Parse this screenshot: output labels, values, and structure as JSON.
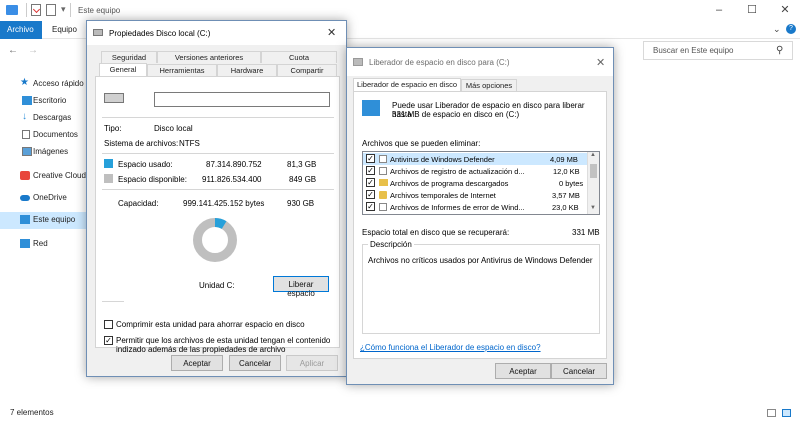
{
  "explorer": {
    "title": "Este equipo",
    "ribbon": {
      "file": "Archivo",
      "equipo": "Equipo"
    },
    "search_placeholder": "Buscar en Este equipo",
    "nav": [
      {
        "label": "Acceso rápido"
      },
      {
        "label": "Escritorio"
      },
      {
        "label": "Descargas"
      },
      {
        "label": "Documentos"
      },
      {
        "label": "Imágenes"
      },
      {
        "label": "Creative Cloud"
      },
      {
        "label": "OneDrive"
      },
      {
        "label": "Este equipo"
      },
      {
        "label": "Red"
      }
    ],
    "status": "7 elementos"
  },
  "props": {
    "title": "Propiedades Disco local (C:)",
    "tabs_top": [
      "Seguridad",
      "Versiones anteriores",
      "Cuota"
    ],
    "tabs_bottom": [
      "General",
      "Herramientas",
      "Hardware",
      "Compartir"
    ],
    "name_value": "",
    "type_label": "Tipo:",
    "type_value": "Disco local",
    "fs_label": "Sistema de archivos:",
    "fs_value": "NTFS",
    "used_label": "Espacio usado:",
    "used_bytes": "87.314.890.752",
    "used_gb": "81,3 GB",
    "free_label": "Espacio disponible:",
    "free_bytes": "911.826.534.400",
    "free_gb": "849 GB",
    "cap_label": "Capacidad:",
    "cap_bytes": "999.141.425.152 bytes",
    "cap_gb": "930 GB",
    "used_fraction": 0.087,
    "drive_label": "Unidad C:",
    "cleanup_button": "Liberar espacio",
    "compress_label": "Comprimir esta unidad para ahorrar espacio en disco",
    "index_label_1": "Permitir que los archivos de esta unidad tengan el contenido",
    "index_label_2": "indizado además de las propiedades de archivo",
    "ok": "Aceptar",
    "cancel": "Cancelar",
    "apply": "Aplicar",
    "colors": {
      "used": "#26a0da",
      "free": "#bfbfbf"
    }
  },
  "cleanup": {
    "title": "Liberador de espacio en disco para  (C:)",
    "tab_active": "Liberador de espacio en disco",
    "tab_other": "Más opciones",
    "intro_1": "Puede usar Liberador de espacio en disco para liberar hasta",
    "intro_2": "331 MB de espacio en disco en  (C:)",
    "list_label": "Archivos que se pueden eliminar:",
    "items": [
      {
        "name": "Antivirus de Windows Defender",
        "size": "4,09 MB"
      },
      {
        "name": "Archivos de registro de actualización d...",
        "size": "12,0 KB"
      },
      {
        "name": "Archivos de programa descargados",
        "size": "0 bytes"
      },
      {
        "name": "Archivos temporales de Internet",
        "size": "3,57 MB"
      },
      {
        "name": "Archivos de Informes de error de Wind...",
        "size": "23,0 KB"
      }
    ],
    "total_label": "Espacio total en disco que se recuperará:",
    "total_value": "331 MB",
    "desc_label": "Descripción",
    "desc_text": "Archivos no críticos usados por Antivirus de Windows Defender",
    "help_link": "¿Cómo funciona el Liberador de espacio en disco?",
    "ok": "Aceptar",
    "cancel": "Cancelar"
  }
}
